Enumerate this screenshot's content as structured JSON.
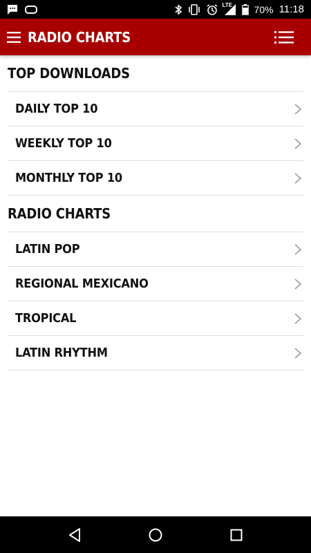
{
  "status_bar": {
    "battery_percent": "70%",
    "time": "11:18",
    "network_label": "LTE",
    "icons": [
      "chat-notification-icon",
      "voicemail-icon",
      "bluetooth-icon",
      "vibrate-icon",
      "alarm-icon",
      "signal-icon",
      "battery-icon"
    ]
  },
  "app_bar": {
    "title": "RADIO CHARTS",
    "menu_icon": "hamburger-menu-icon",
    "right_icon": "list-icon",
    "color": "#a80000"
  },
  "sections": [
    {
      "header": "TOP DOWNLOADS",
      "items": [
        {
          "label": "DAILY TOP 10"
        },
        {
          "label": "WEEKLY TOP 10"
        },
        {
          "label": "MONTHLY TOP 10"
        }
      ]
    },
    {
      "header": "RADIO CHARTS",
      "items": [
        {
          "label": "LATIN POP"
        },
        {
          "label": "REGIONAL MEXICANO"
        },
        {
          "label": "TROPICAL"
        },
        {
          "label": "LATIN RHYTHM"
        }
      ]
    }
  ],
  "nav_bar": {
    "icons": [
      "back-icon",
      "home-icon",
      "recents-icon"
    ]
  }
}
